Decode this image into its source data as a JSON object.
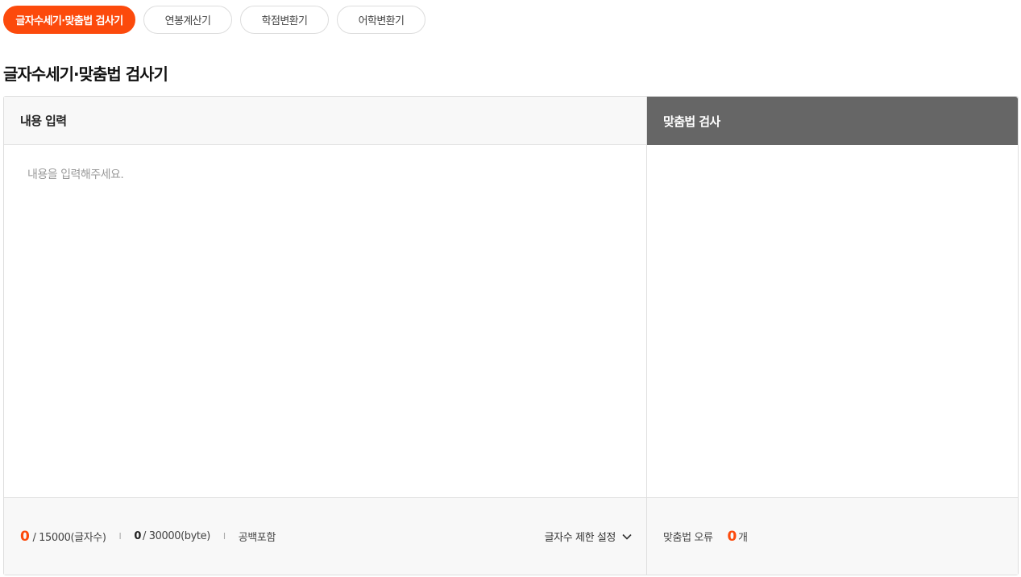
{
  "tabs": [
    {
      "label": "글자수세기·맞춤법 검사기",
      "active": true
    },
    {
      "label": "연봉계산기",
      "active": false
    },
    {
      "label": "학점변환기",
      "active": false
    },
    {
      "label": "어학변환기",
      "active": false
    }
  ],
  "page_title": "글자수세기·맞춤법 검사기",
  "input_panel": {
    "header": "내용 입력",
    "placeholder": "내용을 입력해주세요.",
    "value": ""
  },
  "spell_panel": {
    "header": "맞춤법 검사"
  },
  "footer": {
    "char_count": "0",
    "char_limit": "/ 15000(글자수)",
    "separator": "I",
    "byte_count": "0",
    "byte_limit": "/ 30000(byte)",
    "space_option": "공백포함",
    "limit_setting": "글자수 제한 설정",
    "error_label": "맞춤법 오류",
    "error_count": "0",
    "error_unit": "개"
  },
  "colors": {
    "accent": "#fc4a0c",
    "spell_header_bg": "#666666"
  },
  "icons": {
    "limit_toggle": "chevron-down-icon"
  }
}
